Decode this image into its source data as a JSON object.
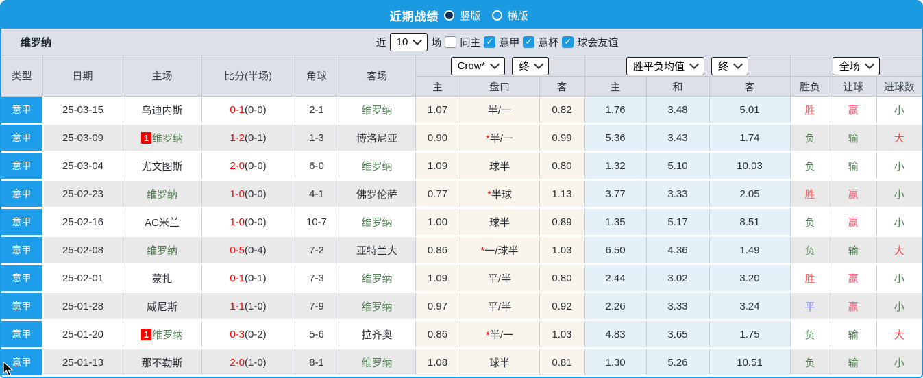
{
  "titlebar": {
    "title": "近期战绩",
    "radios": [
      {
        "label": "竖版",
        "selected": true
      },
      {
        "label": "横版",
        "selected": false
      }
    ]
  },
  "filterbar": {
    "team": "维罗纳",
    "near_label": "近",
    "count_value": "10",
    "games_label": "场",
    "checks": [
      {
        "label": "同主",
        "checked": false
      },
      {
        "label": "意甲",
        "checked": true
      },
      {
        "label": "意杯",
        "checked": true
      },
      {
        "label": "球会友谊",
        "checked": true
      }
    ]
  },
  "header": {
    "cols": [
      "类型",
      "日期",
      "主场",
      "比分(半场)",
      "角球",
      "客场"
    ],
    "group1": {
      "bookmaker": "Crow*",
      "time": "终"
    },
    "group2": {
      "label": "胜平负均值",
      "time": "终"
    },
    "group3": {
      "label": "全场"
    },
    "sub": [
      "主",
      "盘口",
      "客",
      "主",
      "和",
      "客",
      "胜负",
      "让球",
      "进球数"
    ]
  },
  "table": {
    "rows": [
      {
        "league": "意甲",
        "date": "25-03-15",
        "home": "乌迪内斯",
        "home_badge": "",
        "score": "0-1",
        "half": "(0-0)",
        "corner": "2-1",
        "away": "维罗纳",
        "odds_home": "1.07",
        "handicap": "半/一",
        "odds_away": "0.82",
        "avg_home": "1.76",
        "avg_draw": "3.48",
        "avg_away": "5.01",
        "result": "胜",
        "handicap_result": "赢",
        "goals": "小"
      },
      {
        "league": "意甲",
        "date": "25-03-09",
        "home": "维罗纳",
        "home_badge": "1",
        "score": "1-2",
        "half": "(0-1)",
        "corner": "1-3",
        "away": "博洛尼亚",
        "odds_home": "0.90",
        "handicap": "*半/一",
        "odds_away": "0.99",
        "avg_home": "5.36",
        "avg_draw": "3.43",
        "avg_away": "1.74",
        "result": "负",
        "handicap_result": "输",
        "goals": "大"
      },
      {
        "league": "意甲",
        "date": "25-03-04",
        "home": "尤文图斯",
        "home_badge": "",
        "score": "2-0",
        "half": "(0-0)",
        "corner": "6-0",
        "away": "维罗纳",
        "odds_home": "1.09",
        "handicap": "球半",
        "odds_away": "0.80",
        "avg_home": "1.32",
        "avg_draw": "5.10",
        "avg_away": "10.03",
        "result": "负",
        "handicap_result": "输",
        "goals": "小"
      },
      {
        "league": "意甲",
        "date": "25-02-23",
        "home": "维罗纳",
        "home_badge": "",
        "score": "1-0",
        "half": "(0-0)",
        "corner": "4-1",
        "away": "佛罗伦萨",
        "odds_home": "0.77",
        "handicap": "*半球",
        "odds_away": "1.13",
        "avg_home": "3.77",
        "avg_draw": "3.33",
        "avg_away": "2.05",
        "result": "胜",
        "handicap_result": "赢",
        "goals": "小"
      },
      {
        "league": "意甲",
        "date": "25-02-16",
        "home": "AC米兰",
        "home_badge": "",
        "score": "1-0",
        "half": "(0-0)",
        "corner": "10-7",
        "away": "维罗纳",
        "odds_home": "1.00",
        "handicap": "球半",
        "odds_away": "0.89",
        "avg_home": "1.35",
        "avg_draw": "5.17",
        "avg_away": "8.51",
        "result": "负",
        "handicap_result": "赢",
        "goals": "小"
      },
      {
        "league": "意甲",
        "date": "25-02-08",
        "home": "维罗纳",
        "home_badge": "",
        "score": "0-5",
        "half": "(0-4)",
        "corner": "7-2",
        "away": "亚特兰大",
        "odds_home": "0.86",
        "handicap": "*一/球半",
        "odds_away": "1.03",
        "avg_home": "6.50",
        "avg_draw": "4.36",
        "avg_away": "1.49",
        "result": "负",
        "handicap_result": "输",
        "goals": "大"
      },
      {
        "league": "意甲",
        "date": "25-02-01",
        "home": "蒙扎",
        "home_badge": "",
        "score": "0-1",
        "half": "(0-1)",
        "corner": "7-3",
        "away": "维罗纳",
        "odds_home": "1.09",
        "handicap": "平/半",
        "odds_away": "0.80",
        "avg_home": "2.44",
        "avg_draw": "3.02",
        "avg_away": "3.20",
        "result": "胜",
        "handicap_result": "赢",
        "goals": "小"
      },
      {
        "league": "意甲",
        "date": "25-01-28",
        "home": "威尼斯",
        "home_badge": "",
        "score": "1-1",
        "half": "(1-0)",
        "corner": "7-9",
        "away": "维罗纳",
        "odds_home": "0.97",
        "handicap": "平/半",
        "odds_away": "0.92",
        "avg_home": "2.26",
        "avg_draw": "3.33",
        "avg_away": "3.24",
        "result": "平",
        "handicap_result": "赢",
        "goals": "小"
      },
      {
        "league": "意甲",
        "date": "25-01-20",
        "home": "维罗纳",
        "home_badge": "1",
        "score": "0-3",
        "half": "(0-2)",
        "corner": "5-6",
        "away": "拉齐奥",
        "odds_home": "0.86",
        "handicap": "*半/一",
        "odds_away": "1.03",
        "avg_home": "4.83",
        "avg_draw": "3.65",
        "avg_away": "1.75",
        "result": "负",
        "handicap_result": "输",
        "goals": "大"
      },
      {
        "league": "意甲",
        "date": "25-01-13",
        "home": "那不勒斯",
        "home_badge": "",
        "score": "2-0",
        "half": "(1-0)",
        "corner": "8-1",
        "away": "维罗纳",
        "odds_home": "1.08",
        "handicap": "球半",
        "odds_away": "0.81",
        "avg_home": "1.30",
        "avg_draw": "5.26",
        "avg_away": "10.51",
        "result": "负",
        "handicap_result": "输",
        "goals": "小"
      }
    ]
  },
  "colors": {
    "accent_blue": "#1c9ae1",
    "league_cell_blue": "#1e9eea",
    "row_alt_gray": "#e9e9e9",
    "odds_cream": "#faf5ec",
    "avg_light_blue": "#e4f1f9",
    "score_red": "#fe0000",
    "team_green": "#4e7d50",
    "win_red": "#ff6a6a",
    "handicap_win_pink": "#ff5a78",
    "draw_blue": "#8080fa",
    "big_red": "#ff4040"
  }
}
